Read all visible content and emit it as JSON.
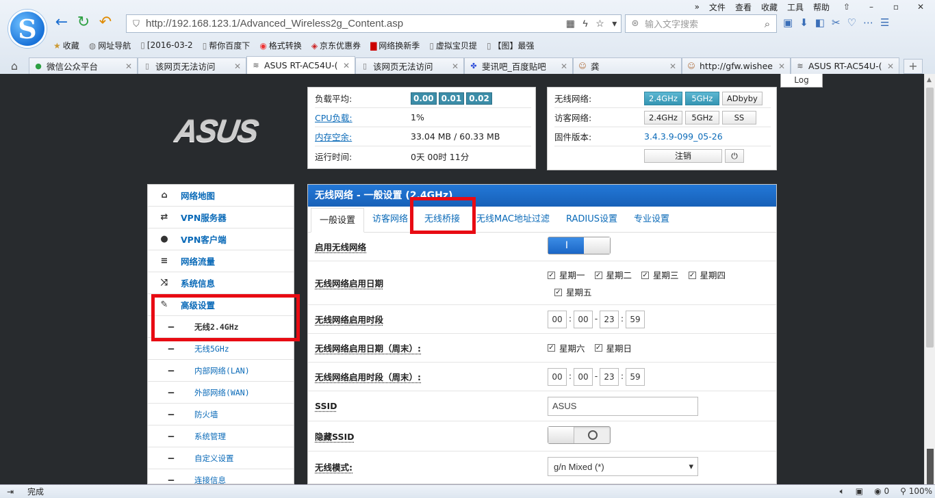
{
  "browser": {
    "menu": [
      "文件",
      "查看",
      "收藏",
      "工具",
      "帮助"
    ],
    "url": "http://192.168.123.1/Advanced_Wireless2g_Content.asp",
    "search_placeholder": "输入文字搜索",
    "bookmarks": [
      "收藏",
      "网址导航",
      "[2016-03-2",
      "帮你百度下",
      "格式转换",
      "京东优惠券",
      "网络换新季",
      "虚拟宝贝提",
      "【图】最强"
    ],
    "tabs": [
      {
        "title": "微信公众平台",
        "icon": "wechat-icon"
      },
      {
        "title": "该网页无法访问",
        "icon": "page-icon"
      },
      {
        "title": "ASUS RT-AC54U-(",
        "icon": "wifi-icon"
      },
      {
        "title": "该网页无法访问",
        "icon": "page-icon"
      },
      {
        "title": "斐讯吧_百度贴吧",
        "icon": "baidu-icon"
      },
      {
        "title": "龚",
        "icon": "avatar-icon"
      },
      {
        "title": "http://gfw.wishee",
        "icon": "avatar-icon"
      },
      {
        "title": "ASUS RT-AC54U-(",
        "icon": "wifi-icon"
      }
    ],
    "status": "完成",
    "zoom": "100%",
    "counter": "0"
  },
  "log_label": "Log",
  "logo_text": "ASUS",
  "system": {
    "load_label": "负载平均:",
    "load": [
      "0.00",
      "0.01",
      "0.02"
    ],
    "cpu_label": "CPU负载:",
    "cpu": "1%",
    "mem_label": "内存空余:",
    "mem": "33.04 MB / 60.33 MB",
    "uptime_label": "运行时间:",
    "uptime": "0天 00时 11分"
  },
  "wireless_status": {
    "wl_label": "无线网络:",
    "wl_buttons": [
      "2.4GHz",
      "5GHz",
      "ADbyby"
    ],
    "guest_label": "访客网络:",
    "guest_buttons": [
      "2.4GHz",
      "5GHz",
      "SS"
    ],
    "fw_label": "固件版本:",
    "fw": "3.4.3.9-099_05-26",
    "logout": "注销"
  },
  "sidebar": {
    "items": [
      {
        "label": "网络地图",
        "icon": "home-icon",
        "glyph": "⌂"
      },
      {
        "label": "VPN服务器",
        "icon": "retweet-icon",
        "glyph": "⇄"
      },
      {
        "label": "VPN客户端",
        "icon": "globe-icon",
        "glyph": "●"
      },
      {
        "label": "网络流量",
        "icon": "list-icon",
        "glyph": "≡"
      },
      {
        "label": "系统信息",
        "icon": "shuffle-icon",
        "glyph": "⤨"
      },
      {
        "label": "高级设置",
        "icon": "wrench-icon",
        "glyph": "✎"
      }
    ],
    "sub": [
      "无线2.4GHz",
      "无线5GHz",
      "内部网络(LAN)",
      "外部网络(WAN)",
      "防火墙",
      "系统管理",
      "自定义设置",
      "连接信息"
    ]
  },
  "main": {
    "title": "无线网络 - 一般设置 (2.4GHz)",
    "tabs": [
      "一般设置",
      "访客网络",
      "无线桥接",
      "无线MAC地址过滤",
      "RADIUS设置",
      "专业设置"
    ],
    "enable_label": "启用无线网络",
    "enable_on": "I",
    "days_label": "无线网络启用日期",
    "days": [
      "星期一",
      "星期二",
      "星期三",
      "星期四",
      "星期五"
    ],
    "time_label": "无线网络启用时段",
    "time": [
      "00",
      "00",
      "23",
      "59"
    ],
    "wdays_label": "无线网络启用日期（周末）:",
    "wdays": [
      "星期六",
      "星期日"
    ],
    "wtime_label": "无线网络启用时段（周末）:",
    "wtime": [
      "00",
      "00",
      "23",
      "59"
    ],
    "ssid_label": "SSID",
    "ssid": "ASUS",
    "hide_label": "隐藏SSID",
    "mode_label": "无线模式:",
    "mode": "g/n Mixed (*)"
  },
  "colors": {
    "accent": "#1a6dd0",
    "highlight": "#e80b13",
    "badge": "#3c8da8"
  }
}
